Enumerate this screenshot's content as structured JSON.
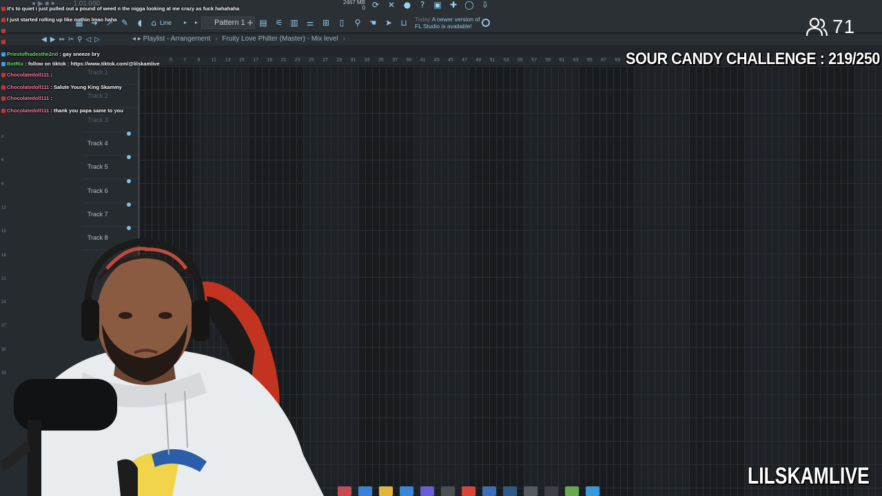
{
  "toolbar": {
    "line_label": "Line",
    "pattern_label": "Pattern 1",
    "pattern_add": "+",
    "notice_prefix": "Today",
    "notice_line1": "A newer version of",
    "notice_line2": "FL Studio is available!",
    "counter_top": "2467 MB",
    "counter_bottom": "0"
  },
  "playlist": {
    "breadcrumb_1": "Playlist - Arrangement",
    "breadcrumb_2": "Fruity Love Philter (Master) - Mix level",
    "breadcrumb_sep": "›",
    "ruler_marks": [
      "5",
      "7",
      "9",
      "11",
      "13",
      "15",
      "17",
      "19",
      "21",
      "23",
      "25",
      "27",
      "29",
      "31",
      "33",
      "35",
      "37",
      "39",
      "41",
      "43",
      "45",
      "47",
      "49",
      "51",
      "53",
      "55",
      "57",
      "59",
      "61",
      "63",
      "65",
      "67",
      "69"
    ],
    "tracks": [
      {
        "label": "Track 1"
      },
      {
        "label": "Track 2"
      },
      {
        "label": "Track 3"
      },
      {
        "label": "Track 4"
      },
      {
        "label": "Track 5"
      },
      {
        "label": "Track 6"
      },
      {
        "label": "Track 7"
      },
      {
        "label": "Track 8"
      }
    ],
    "row_numbers": [
      "3",
      "6",
      "9",
      "12",
      "15",
      "18",
      "21",
      "24",
      "27",
      "30",
      "33"
    ]
  },
  "chat": [
    {
      "user": "",
      "text": "it's to quiet i just pulled out a pound of weed n the nigga looking at me crazy as fuck hahahaha",
      "color": "#ff4f4f"
    },
    {
      "user": "",
      "text": "I just started rolling up like nothin lmao haha",
      "color": "#ff4f4f"
    },
    {
      "user": "",
      "text": "",
      "color": "#ff4f4f"
    },
    {
      "user": "",
      "text": "",
      "color": "#ff4f4f"
    },
    {
      "user": "Priestofhadesthe2nd",
      "text": ": gay sneeze bry",
      "color": "#6fdc6f"
    },
    {
      "user": "BotRix",
      "text": ": follow on tiktok : https://www.tiktok.com/@lilskamlive",
      "color": "#6fdc6f"
    },
    {
      "user": "Chocolatedoll111",
      "text": ":",
      "color": "#ff7aa0"
    },
    {
      "user": "Chocolatedoll111",
      "text": ": Salute Young King Skammy",
      "color": "#ff7aa0"
    },
    {
      "user": "Chocolatedoll111",
      "text": ":",
      "color": "#ff7aa0"
    },
    {
      "user": "Chocolatedoll111",
      "text": ": thank you papa same to you",
      "color": "#ff7aa0"
    }
  ],
  "viewers": {
    "count": "71"
  },
  "overlay": {
    "challenge": "SOUR CANDY CHALLENGE : 219/250",
    "channel": "LILSKAMLIVE"
  },
  "colors": {
    "accent": "#8fc7e8",
    "grid_bg": "#1e2226",
    "panel_bg": "#262b30"
  }
}
